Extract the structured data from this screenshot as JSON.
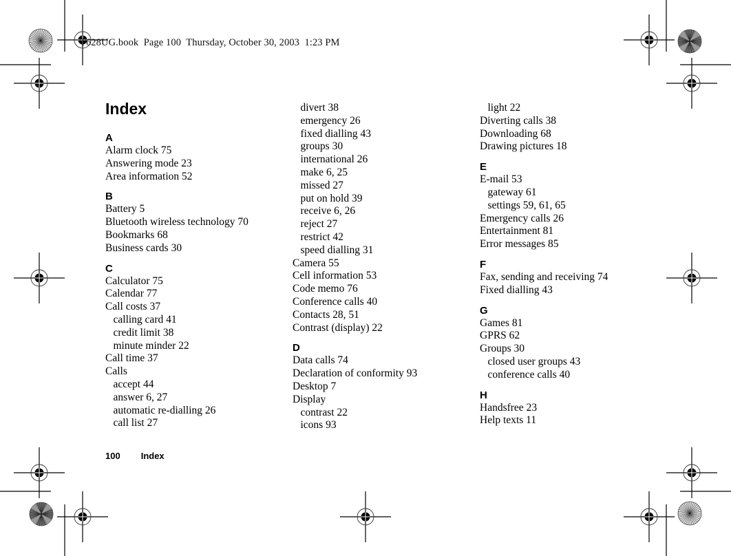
{
  "slug": "T628UG.book  Page 100  Thursday, October 30, 2003  1:23 PM",
  "title": "Index",
  "footer": {
    "page_number": "100",
    "section": "Index"
  },
  "columns": [
    {
      "groups": [
        {
          "letter": "A",
          "entries": [
            {
              "text": "Alarm clock 75",
              "sub": false
            },
            {
              "text": "Answering mode 23",
              "sub": false
            },
            {
              "text": "Area information 52",
              "sub": false
            }
          ]
        },
        {
          "letter": "B",
          "entries": [
            {
              "text": "Battery 5",
              "sub": false
            },
            {
              "text": "Bluetooth wireless technology 70",
              "sub": false
            },
            {
              "text": "Bookmarks 68",
              "sub": false
            },
            {
              "text": "Business cards 30",
              "sub": false
            }
          ]
        },
        {
          "letter": "C",
          "entries": [
            {
              "text": "Calculator 75",
              "sub": false
            },
            {
              "text": "Calendar 77",
              "sub": false
            },
            {
              "text": "Call costs 37",
              "sub": false
            },
            {
              "text": "calling card 41",
              "sub": true
            },
            {
              "text": "credit limit 38",
              "sub": true
            },
            {
              "text": "minute minder 22",
              "sub": true
            },
            {
              "text": "Call time 37",
              "sub": false
            },
            {
              "text": "Calls",
              "sub": false
            },
            {
              "text": "accept 44",
              "sub": true
            },
            {
              "text": "answer 6, 27",
              "sub": true
            },
            {
              "text": "automatic re-dialling 26",
              "sub": true
            },
            {
              "text": "call list 27",
              "sub": true
            }
          ]
        }
      ]
    },
    {
      "groups": [
        {
          "letter": "",
          "entries": [
            {
              "text": "divert 38",
              "sub": true
            },
            {
              "text": "emergency 26",
              "sub": true
            },
            {
              "text": "fixed dialling 43",
              "sub": true
            },
            {
              "text": "groups 30",
              "sub": true
            },
            {
              "text": "international 26",
              "sub": true
            },
            {
              "text": "make 6, 25",
              "sub": true
            },
            {
              "text": "missed 27",
              "sub": true
            },
            {
              "text": "put on hold 39",
              "sub": true
            },
            {
              "text": "receive 6, 26",
              "sub": true
            },
            {
              "text": "reject 27",
              "sub": true
            },
            {
              "text": "restrict 42",
              "sub": true
            },
            {
              "text": "speed dialling 31",
              "sub": true
            },
            {
              "text": "Camera 55",
              "sub": false
            },
            {
              "text": "Cell information 53",
              "sub": false
            },
            {
              "text": "Code memo 76",
              "sub": false
            },
            {
              "text": "Conference calls 40",
              "sub": false
            },
            {
              "text": "Contacts 28, 51",
              "sub": false
            },
            {
              "text": "Contrast (display) 22",
              "sub": false
            }
          ]
        },
        {
          "letter": "D",
          "entries": [
            {
              "text": "Data calls 74",
              "sub": false
            },
            {
              "text": "Declaration of conformity 93",
              "sub": false
            },
            {
              "text": "Desktop 7",
              "sub": false
            },
            {
              "text": "Display",
              "sub": false
            },
            {
              "text": "contrast 22",
              "sub": true
            },
            {
              "text": "icons 93",
              "sub": true
            }
          ]
        }
      ]
    },
    {
      "groups": [
        {
          "letter": "",
          "entries": [
            {
              "text": "light 22",
              "sub": true
            },
            {
              "text": "Diverting calls 38",
              "sub": false
            },
            {
              "text": "Downloading 68",
              "sub": false
            },
            {
              "text": "Drawing pictures 18",
              "sub": false
            }
          ]
        },
        {
          "letter": "E",
          "entries": [
            {
              "text": "E-mail 53",
              "sub": false
            },
            {
              "text": "gateway 61",
              "sub": true
            },
            {
              "text": "settings 59, 61, 65",
              "sub": true
            },
            {
              "text": "Emergency calls 26",
              "sub": false
            },
            {
              "text": "Entertainment 81",
              "sub": false
            },
            {
              "text": "Error messages 85",
              "sub": false
            }
          ]
        },
        {
          "letter": "F",
          "entries": [
            {
              "text": "Fax, sending and receiving 74",
              "sub": false
            },
            {
              "text": "Fixed dialling 43",
              "sub": false
            }
          ]
        },
        {
          "letter": "G",
          "entries": [
            {
              "text": "Games 81",
              "sub": false
            },
            {
              "text": "GPRS 62",
              "sub": false
            },
            {
              "text": "Groups 30",
              "sub": false
            },
            {
              "text": "closed user groups 43",
              "sub": true
            },
            {
              "text": "conference calls 40",
              "sub": true
            }
          ]
        },
        {
          "letter": "H",
          "entries": [
            {
              "text": "Handsfree 23",
              "sub": false
            },
            {
              "text": "Help texts 11",
              "sub": false
            }
          ]
        }
      ]
    }
  ]
}
